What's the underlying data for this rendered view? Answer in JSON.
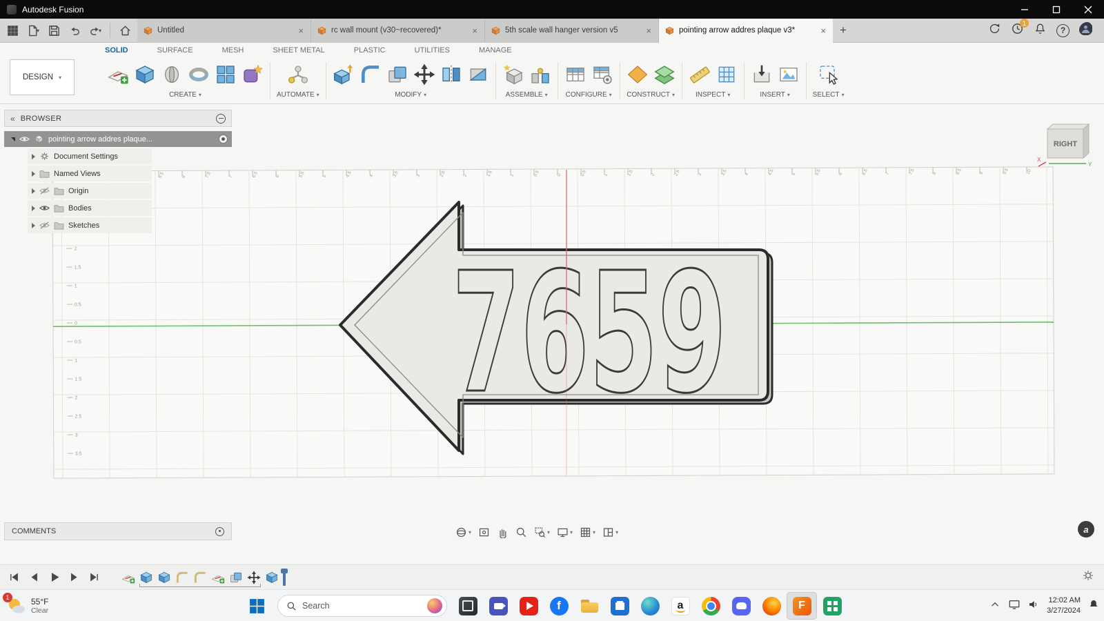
{
  "icons": {
    "close": "×",
    "new_tab": "+",
    "collapse": "«",
    "help": "?"
  },
  "window": {
    "title": "Autodesk Fusion"
  },
  "doc_tabs": [
    {
      "label": "Untitled"
    },
    {
      "label": "rc wall mount (v30~recovered)*"
    },
    {
      "label": "5th scale wall hanger  version v5"
    },
    {
      "label": "pointing arrow addres  plaque v3*"
    }
  ],
  "tab_strip_right": {
    "job_badge": "1"
  },
  "ribbon": {
    "workspace_label": "DESIGN",
    "tabs": [
      "SOLID",
      "SURFACE",
      "MESH",
      "SHEET METAL",
      "PLASTIC",
      "UTILITIES",
      "MANAGE"
    ],
    "active_tab": "SOLID",
    "groups": [
      {
        "label": "CREATE"
      },
      {
        "label": "AUTOMATE"
      },
      {
        "label": "MODIFY"
      },
      {
        "label": "ASSEMBLE"
      },
      {
        "label": "CONFIGURE"
      },
      {
        "label": "CONSTRUCT"
      },
      {
        "label": "INSPECT"
      },
      {
        "label": "INSERT"
      },
      {
        "label": "SELECT"
      }
    ]
  },
  "browser": {
    "title": "BROWSER",
    "root_label": "pointing arrow addres  plaque...",
    "items": [
      {
        "label": "Document Settings"
      },
      {
        "label": "Named Views"
      },
      {
        "label": "Origin"
      },
      {
        "label": "Bodies"
      },
      {
        "label": "Sketches"
      }
    ]
  },
  "viewport": {
    "viewcube_face": "RIGHT",
    "axis_x": "X",
    "axis_y": "Y",
    "plaque_text": "7659",
    "top_ruler": [
      "10.5",
      "10",
      "9.5",
      "9",
      "8.5",
      "8",
      "7.5",
      "7",
      "6.5",
      "6",
      "5.5",
      "5",
      "4.5",
      "4",
      "3.5",
      "3",
      "2.5",
      "2",
      "1.5",
      "1",
      "0.5",
      "0",
      "0.5",
      "1",
      "1.5",
      "2",
      "2.5",
      "3",
      "3.5",
      "4",
      "4.5",
      "5",
      "5.5",
      "6",
      "6.5",
      "7",
      "7.5",
      "8",
      "8.5",
      "9",
      "9.5",
      "10"
    ],
    "left_ruler": [
      "2",
      "1.5",
      "1",
      "0.5",
      "0",
      "0.5",
      "1",
      "1.5",
      "2",
      "2.5",
      "3",
      "3.5"
    ]
  },
  "comments": {
    "title": "COMMENTS"
  },
  "timeline": {
    "features": [
      "sketch",
      "extrude",
      "extrude",
      "chamfer",
      "chamfer",
      "sketch",
      "combine",
      "move",
      "extrude"
    ]
  },
  "taskbar": {
    "weather": {
      "temp": "55°F",
      "condition": "Clear",
      "badge": "1"
    },
    "search_placeholder": "Search",
    "apps": [
      "task-view",
      "teams",
      "youtube",
      "facebook",
      "file-explorer",
      "store",
      "edge",
      "amazon",
      "chrome",
      "discord",
      "firefox",
      "fusion-360",
      "sheets-green"
    ],
    "clock": {
      "time": "12:02 AM",
      "date": "3/27/2024"
    }
  },
  "colors": {
    "accent_blue": "#4d8fc4",
    "fusion_orange": "#f0801a",
    "axis_green": "#6cbf6c",
    "axis_red": "#d96a6a"
  }
}
